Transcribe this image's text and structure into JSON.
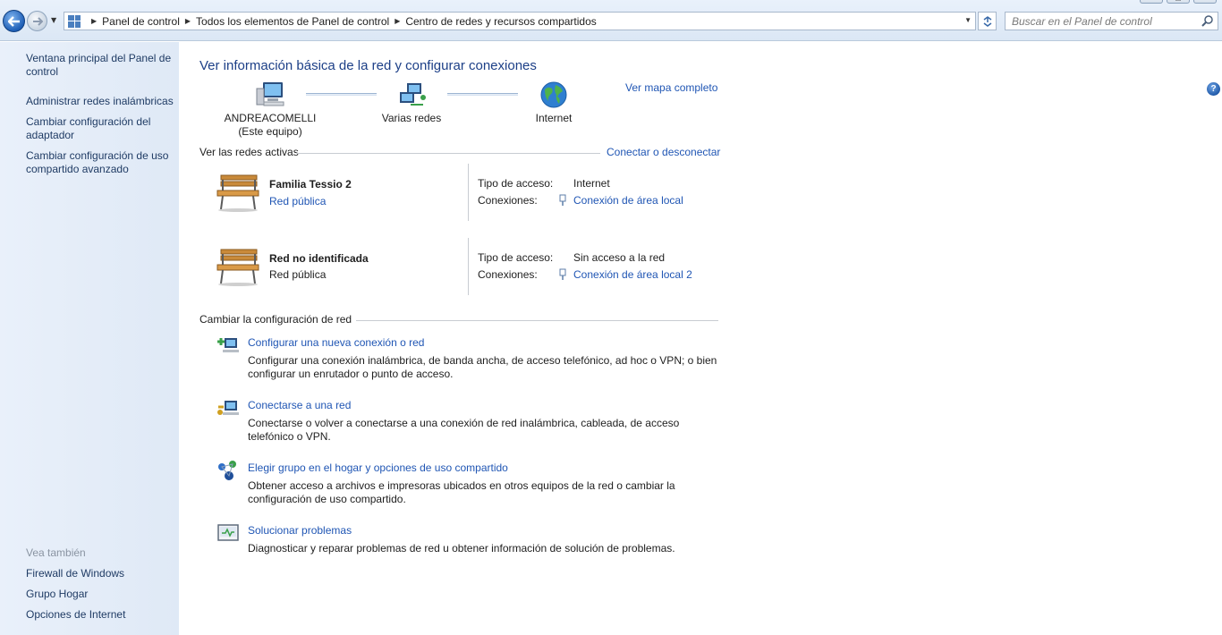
{
  "window": {
    "minimize_glyph": "—",
    "maximize_glyph": "□",
    "close_glyph": "✕"
  },
  "address_bar": {
    "breadcrumbs": [
      "Panel de control",
      "Todos los elementos de Panel de control",
      "Centro de redes y recursos compartidos"
    ]
  },
  "search": {
    "placeholder": "Buscar en el Panel de control"
  },
  "sidebar": {
    "tasks": [
      "Ventana principal del Panel de control",
      "Administrar redes inalámbricas",
      "Cambiar configuración del adaptador",
      "Cambiar configuración de uso compartido avanzado"
    ],
    "see_also_label": "Vea también",
    "see_also": [
      "Firewall de Windows",
      "Grupo Hogar",
      "Opciones de Internet"
    ]
  },
  "main": {
    "title": "Ver información básica de la red y configurar conexiones",
    "map_link": "Ver mapa completo",
    "map": {
      "computer_name": "ANDREACOMELLI",
      "computer_sub": "(Este equipo)",
      "network_label": "Varias redes",
      "internet_label": "Internet"
    },
    "active_networks": {
      "heading": "Ver las redes activas",
      "connect_link": "Conectar o desconectar",
      "access_type_label": "Tipo de acceso:",
      "connections_label": "Conexiones:",
      "networks": [
        {
          "name": "Familia Tessio  2",
          "type": "Red pública",
          "access": "Internet",
          "connection": "Conexión de área local"
        },
        {
          "name": "Red no identificada",
          "type": "Red pública",
          "access": "Sin acceso a la red",
          "connection": "Conexión de área local 2"
        }
      ]
    },
    "change_settings": {
      "heading": "Cambiar la configuración de red",
      "tasks": [
        {
          "title": "Configurar una nueva conexión o red",
          "desc": "Configurar una conexión inalámbrica, de banda ancha, de acceso telefónico, ad hoc o VPN; o bien configurar un enrutador o punto de acceso."
        },
        {
          "title": "Conectarse a una red",
          "desc": "Conectarse o volver a conectarse a una conexión de red inalámbrica, cableada, de acceso telefónico o VPN."
        },
        {
          "title": "Elegir grupo en el hogar y opciones de uso compartido",
          "desc": "Obtener acceso a archivos e impresoras ubicados en otros equipos de la red o cambiar la configuración de uso compartido."
        },
        {
          "title": "Solucionar problemas",
          "desc": "Diagnosticar y reparar problemas de red u obtener información de solución de problemas."
        }
      ]
    }
  },
  "help_glyph": "?",
  "colors": {
    "link": "#2056b4",
    "title": "#1c3f87",
    "sidebar_bg": "#e4ecf7"
  }
}
